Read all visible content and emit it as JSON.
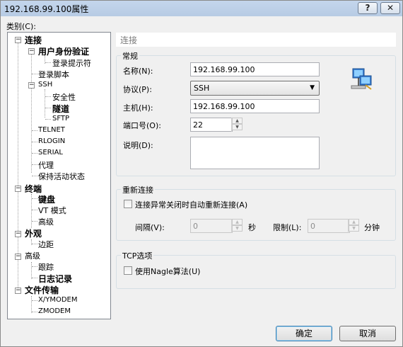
{
  "window": {
    "title": "192.168.99.100属性",
    "help_label": "?",
    "close_label": "✕"
  },
  "category_label": "类别(C):",
  "tree": {
    "connection": "连接",
    "user_auth": "用户身份验证",
    "login_prompt": "登录提示符",
    "login_script": "登录脚本",
    "ssh": "SSH",
    "security": "安全性",
    "tunnel": "隧道",
    "sftp": "SFTP",
    "telnet": "TELNET",
    "rlogin": "RLOGIN",
    "serial": "SERIAL",
    "proxy": "代理",
    "keepalive": "保持活动状态",
    "terminal": "终端",
    "keyboard": "键盘",
    "vt_mode": "VT 模式",
    "advanced1": "高级",
    "appearance": "外观",
    "margin": "边距",
    "advanced2": "高级",
    "trace": "跟踪",
    "logging": "日志记录",
    "file_transfer": "文件传输",
    "xymodem": "X/YMODEM",
    "zmodem": "ZMODEM"
  },
  "section_header": "连接",
  "general": {
    "title": "常规",
    "name_label": "名称(N):",
    "name_value": "192.168.99.100",
    "protocol_label": "协议(P):",
    "protocol_value": "SSH",
    "host_label": "主机(H):",
    "host_value": "192.168.99.100",
    "port_label": "端口号(O):",
    "port_value": "22",
    "desc_label": "说明(D):",
    "desc_value": ""
  },
  "reconnect": {
    "title": "重新连接",
    "auto_label": "连接异常关闭时自动重新连接(A)",
    "interval_label": "间隔(V):",
    "interval_value": "0",
    "seconds_label": "秒",
    "limit_label": "限制(L):",
    "limit_value": "0",
    "minutes_label": "分钟"
  },
  "tcp": {
    "title": "TCP选项",
    "nagle_label": "使用Nagle算法(U)"
  },
  "buttons": {
    "ok": "确定",
    "cancel": "取消"
  },
  "colors": {
    "accent": "#3c7fb1",
    "titlebar": "#b7cbe4"
  }
}
